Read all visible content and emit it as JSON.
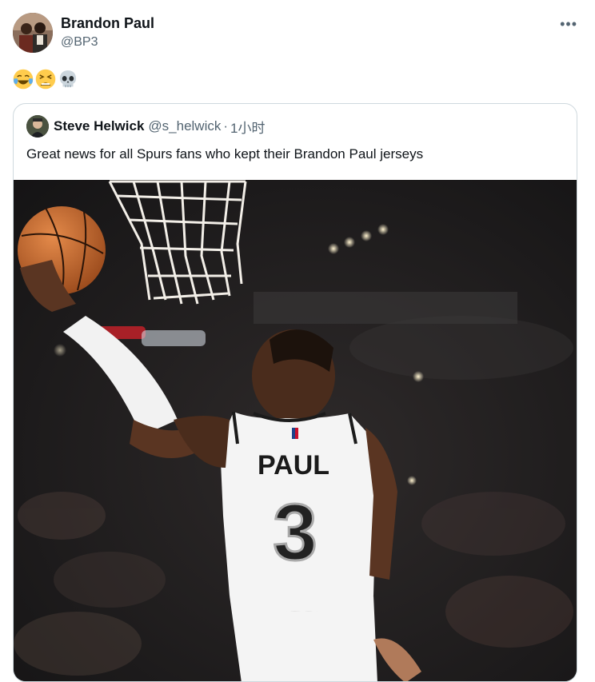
{
  "author": {
    "name": "Brandon Paul",
    "handle": "@BP3"
  },
  "post": {
    "emojis": [
      "joy-emoji",
      "tired-face-emoji",
      "skull-emoji"
    ]
  },
  "quoted": {
    "name": "Steve Helwick",
    "handle": "@s_helwick",
    "separator": "·",
    "time": "1小时",
    "text": "Great news for all Spurs fans who kept their Brandon Paul jerseys",
    "media": {
      "jersey_name": "PAUL",
      "jersey_number": "3"
    }
  },
  "colors": {
    "text_primary": "#0f1419",
    "text_secondary": "#536471",
    "border": "#cfd9de"
  }
}
